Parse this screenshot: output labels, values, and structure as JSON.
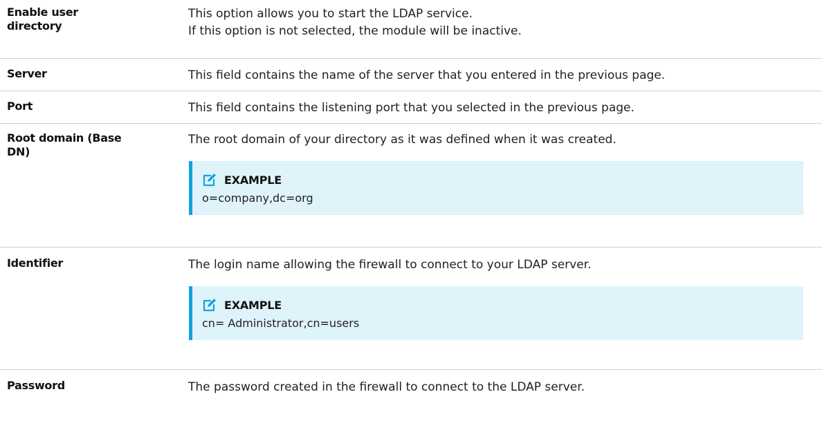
{
  "rows": [
    {
      "label": "Enable user directory",
      "lines": [
        "This option allows you to start the LDAP service.",
        "If this option is not selected, the module will be inactive."
      ]
    },
    {
      "label": "Server",
      "lines": [
        "This field contains the name of the server that you entered in the previous page."
      ]
    },
    {
      "label": "Port",
      "lines": [
        "This field contains the listening port that you selected in the previous page."
      ]
    },
    {
      "label": "Root domain (Base DN)",
      "lines": [
        "The root domain of your directory as it was defined when it was created."
      ],
      "example": {
        "icon": "pencil-edit-icon",
        "title": "EXAMPLE",
        "text": "o=company,dc=org"
      }
    },
    {
      "label": "Identifier",
      "lines": [
        "The login name allowing the firewall to connect to your LDAP server."
      ],
      "example": {
        "icon": "pencil-edit-icon",
        "title": "EXAMPLE",
        "text": "cn= Administrator,cn=users"
      }
    },
    {
      "label": "Password",
      "lines": [
        "The password created in the firewall to connect to the LDAP server."
      ]
    }
  ],
  "colors": {
    "example_background": "#dff3fb",
    "example_border": "#13a3da",
    "divider": "#cfcfcf"
  }
}
